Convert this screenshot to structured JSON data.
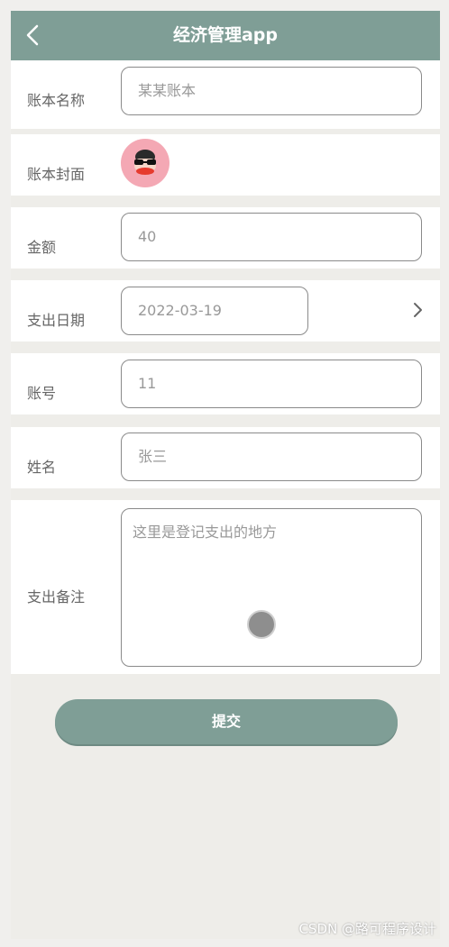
{
  "header": {
    "title": "经济管理app"
  },
  "form": {
    "name_label": "账本名称",
    "name_placeholder": "某某账本",
    "cover_label": "账本封面",
    "amount_label": "金额",
    "amount_value": "40",
    "date_label": "支出日期",
    "date_value": "2022-03-19",
    "account_label": "账号",
    "account_value": "11",
    "person_label": "姓名",
    "person_value": "张三",
    "note_label": "支出备注",
    "note_placeholder": "这里是登记支出的地方"
  },
  "submit_label": "提交",
  "watermark": "CSDN @路可程序设计"
}
